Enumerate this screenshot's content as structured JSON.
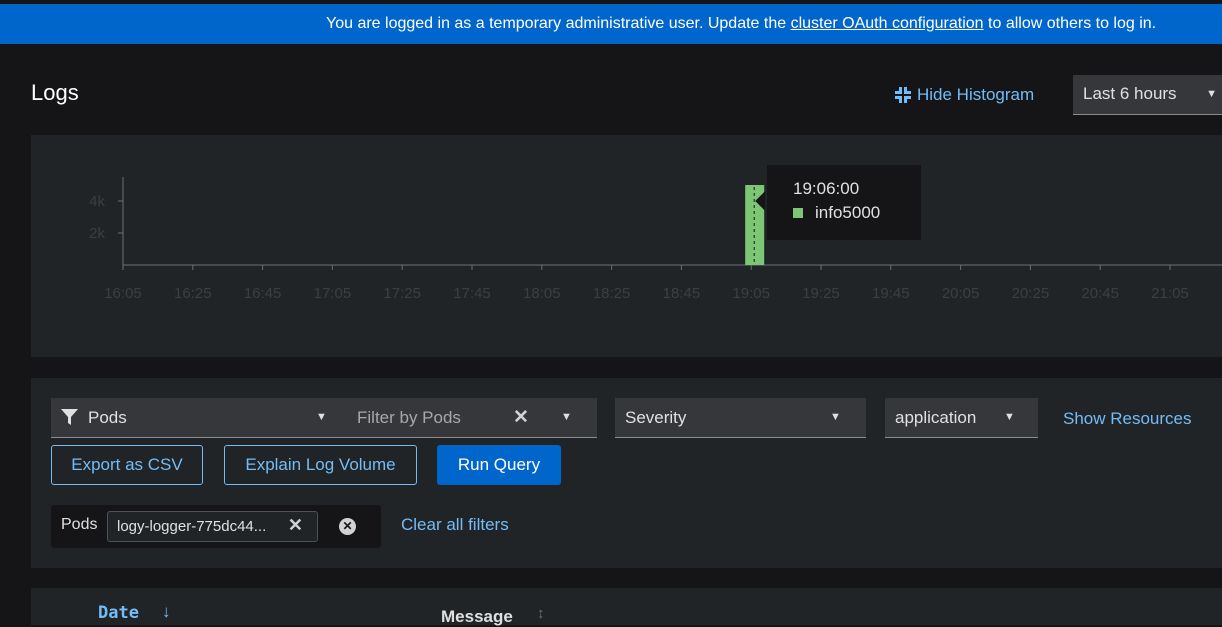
{
  "banner": {
    "prefix": "You are logged in as a temporary administrative user. Update the ",
    "link": "cluster OAuth configuration",
    "suffix": " to allow others to log in."
  },
  "page": {
    "title": "Logs",
    "hide_histogram_label": "Hide Histogram",
    "time_range": "Last 6 hours"
  },
  "chart_data": {
    "type": "bar",
    "x": [
      "16:05",
      "16:25",
      "16:45",
      "17:05",
      "17:25",
      "17:45",
      "18:05",
      "18:25",
      "18:45",
      "19:05",
      "19:25",
      "19:45",
      "20:05",
      "20:25",
      "20:45",
      "21:05"
    ],
    "y_ticks": [
      "2k",
      "4k"
    ],
    "ylim": [
      0,
      5500
    ],
    "series": [
      {
        "name": "info",
        "color": "#7cc674",
        "points": [
          {
            "x": "19:05",
            "value": 5000
          }
        ]
      }
    ],
    "tooltip": {
      "time": "19:06:00",
      "label": "info",
      "value": "5000"
    }
  },
  "filters": {
    "attribute_select": "Pods",
    "filter_placeholder": "Filter by Pods",
    "severity_select": "Severity",
    "tenant_select": "application",
    "show_resources": "Show Resources",
    "export_csv": "Export as CSV",
    "explain_volume": "Explain Log Volume",
    "run_query": "Run Query",
    "chip_group_label": "Pods",
    "chip_value": "logy-logger-775dc44...",
    "clear_all": "Clear all filters"
  },
  "table": {
    "col_date": "Date",
    "col_message": "Message"
  },
  "colors": {
    "banner": "#0066cc",
    "link": "#73bcf7",
    "info": "#7cc674"
  }
}
